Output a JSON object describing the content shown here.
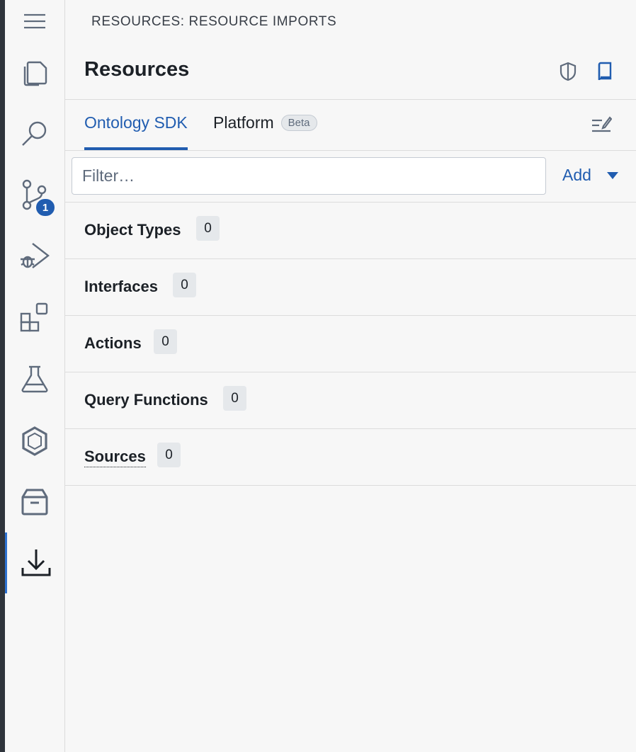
{
  "breadcrumb": "RESOURCES: RESOURCE IMPORTS",
  "title": "Resources",
  "tabs": [
    {
      "label": "Ontology SDK",
      "active": true
    },
    {
      "label": "Platform",
      "tag": "Beta",
      "active": false
    }
  ],
  "filter": {
    "placeholder": "Filter…",
    "value": ""
  },
  "add_label": "Add",
  "source_control_badge": "1",
  "sections": [
    {
      "label": "Object Types",
      "count": "0"
    },
    {
      "label": "Interfaces",
      "count": "0"
    },
    {
      "label": "Actions",
      "count": "0"
    },
    {
      "label": "Query Functions",
      "count": "0"
    },
    {
      "label": "Sources",
      "count": "0"
    }
  ],
  "activity_icons": [
    "menu-icon",
    "files-icon",
    "search-icon",
    "git-branch-icon",
    "run-debug-icon",
    "extensions-icon",
    "flask-icon",
    "ontology-icon",
    "archive-icon",
    "download-icon"
  ],
  "colors": {
    "accent": "#215db0",
    "active_indicator": "#2d72d2",
    "text": "#1c2127",
    "muted": "#5f6b7c"
  }
}
